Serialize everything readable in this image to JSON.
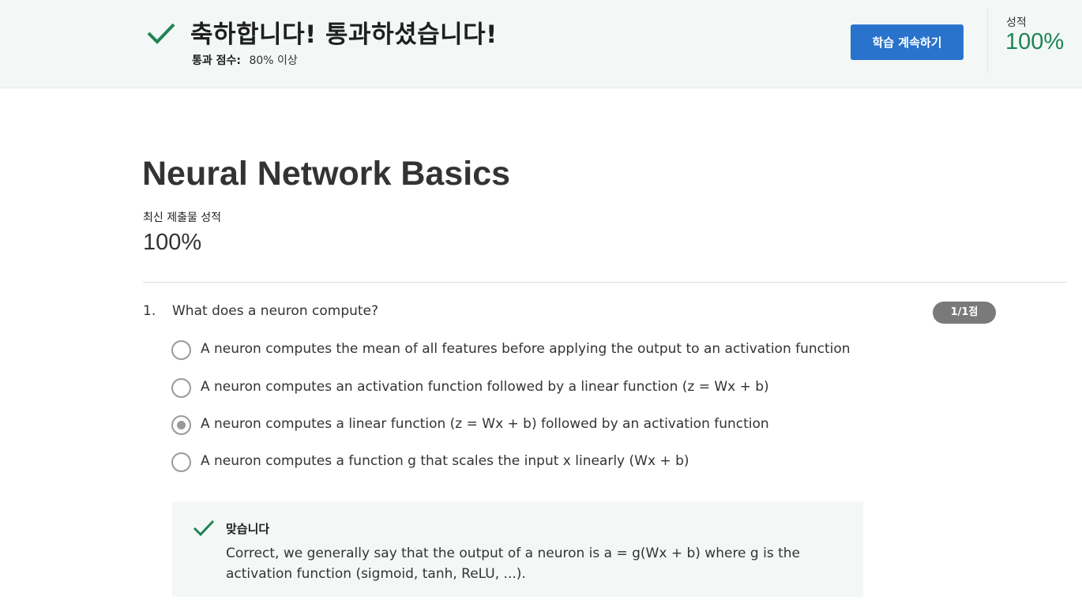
{
  "banner": {
    "title": "축하합니다! 통과하셨습니다!",
    "pass_label": "통과 점수:",
    "pass_value": "80% 이상",
    "continue_label": "학습 계속하기",
    "grade_label": "성적",
    "grade_value": "100%"
  },
  "quiz": {
    "title": "Neural Network Basics",
    "latest_label": "최신 제출물 성적",
    "latest_value": "100%"
  },
  "question": {
    "number": "1.",
    "text": "What does a neuron compute?",
    "points": "1/1점",
    "options": [
      {
        "label": "A neuron computes the mean of all features before applying the output to an activation function",
        "selected": false
      },
      {
        "label": "A neuron computes an activation function followed by a linear function (z = Wx + b)",
        "selected": false
      },
      {
        "label": "A neuron computes a linear function (z = Wx + b) followed by an activation function",
        "selected": true
      },
      {
        "label": "A neuron computes a function g that scales the input x linearly (Wx + b)",
        "selected": false
      }
    ],
    "feedback": {
      "title": "맞습니다",
      "text": "Correct, we generally say that the output of a neuron is a = g(Wx + b) where g is the activation function (sigmoid, tanh, ReLU, ...)."
    }
  },
  "colors": {
    "accent_green": "#1f8354",
    "button_blue": "#2a73cc",
    "banner_bg": "#f3f8f6"
  },
  "icons": {
    "banner": "checkmark-icon",
    "feedback": "checkmark-icon"
  }
}
